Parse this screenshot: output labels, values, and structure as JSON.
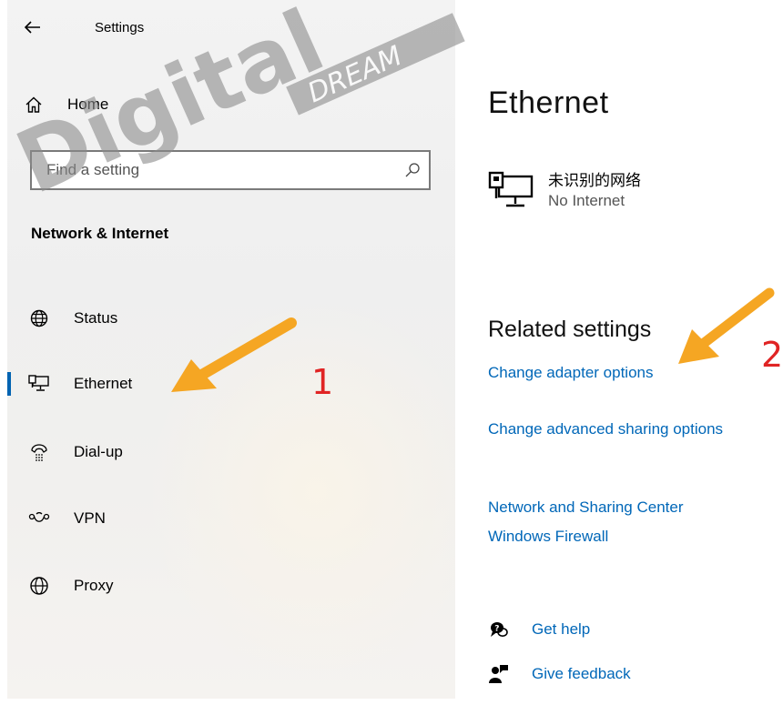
{
  "window": {
    "title": "Settings"
  },
  "sidebar": {
    "home_label": "Home",
    "search_placeholder": "Find a setting",
    "section_title": "Network & Internet",
    "items": [
      {
        "label": "Status",
        "icon": "globe-status-icon"
      },
      {
        "label": "Ethernet",
        "icon": "ethernet-icon",
        "selected": true
      },
      {
        "label": "Dial-up",
        "icon": "dialup-icon"
      },
      {
        "label": "VPN",
        "icon": "vpn-icon"
      },
      {
        "label": "Proxy",
        "icon": "globe-icon"
      }
    ]
  },
  "main": {
    "page_title": "Ethernet",
    "network": {
      "name": "未识别的网络",
      "status": "No Internet"
    },
    "related": {
      "title": "Related settings",
      "links": [
        "Change adapter options",
        "Change advanced sharing options",
        "Network and Sharing Center",
        "Windows Firewall"
      ]
    },
    "help": {
      "get_help": "Get help",
      "feedback": "Give feedback"
    }
  },
  "annotations": {
    "step1": "1",
    "step2": "2"
  },
  "watermark": {
    "brand": "Digital",
    "sub": "DREAM"
  },
  "colors": {
    "accent": "#0063b1",
    "link": "#0067b8",
    "arrow": "#f5a623",
    "number": "#e02424"
  }
}
